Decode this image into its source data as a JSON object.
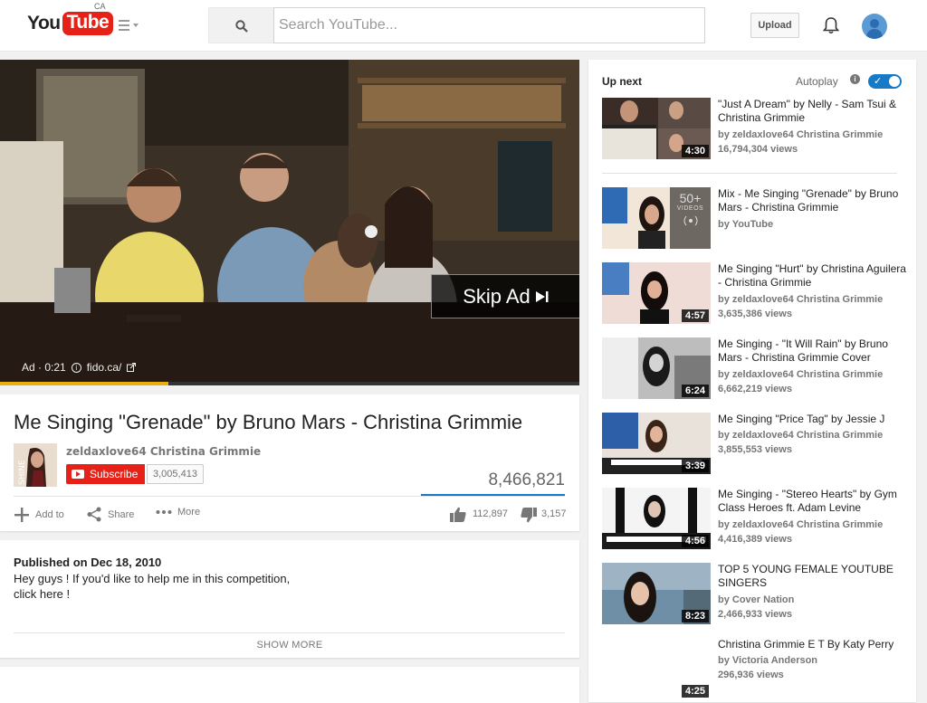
{
  "header": {
    "logo_you": "You",
    "logo_tube": "Tube",
    "logo_region": "CA",
    "search_placeholder": "Search YouTube...",
    "upload_label": "Upload"
  },
  "player": {
    "ad_label": "Ad · 0:21",
    "ad_domain": "fido.ca/",
    "skip_label": "Skip Ad",
    "ad_progress_fraction": 0.29
  },
  "video": {
    "title": "Me Singing \"Grenade\" by Bruno Mars - Christina Grimmie",
    "owner": "zeldaxlove64 Christina Grimmie",
    "subscribe_label": "Subscribe",
    "subscriber_count": "3,005,413",
    "views": "8,466,821",
    "actions": {
      "add_to": "Add to",
      "share": "Share",
      "more": "More"
    },
    "likes": "112,897",
    "dislikes": "3,157"
  },
  "description": {
    "published": "Published on Dec 18, 2010",
    "line1": "Hey guys ! If you'd like to help me in this competition,",
    "line2": "click here !",
    "show_more": "SHOW MORE"
  },
  "sidebar": {
    "up_next": "Up next",
    "autoplay": "Autoplay",
    "items": [
      {
        "title": "\"Just A Dream\" by Nelly - Sam Tsui & Christina Grimmie",
        "by": "by zeldaxlove64 Christina Grimmie",
        "views": "16,794,304 views",
        "duration": "4:30"
      },
      {
        "title": "Mix - Me Singing \"Grenade\" by Bruno Mars - Christina Grimmie",
        "by": "by YouTube",
        "views": "",
        "duration": "",
        "mix_count": "50+",
        "mix_label": "VIDEOS"
      },
      {
        "title": "Me Singing \"Hurt\" by Christina Aguilera - Christina Grimmie",
        "by": "by zeldaxlove64 Christina Grimmie",
        "views": "3,635,386 views",
        "duration": "4:57"
      },
      {
        "title": "Me Singing - \"It Will Rain\" by Bruno Mars - Christina Grimmie Cover",
        "by": "by zeldaxlove64 Christina Grimmie",
        "views": "6,662,219 views",
        "duration": "6:24"
      },
      {
        "title": "Me Singing \"Price Tag\" by Jessie J",
        "by": "by zeldaxlove64 Christina Grimmie",
        "views": "3,855,553 views",
        "duration": "3:39"
      },
      {
        "title": "Me Singing - \"Stereo Hearts\" by Gym Class Heroes ft. Adam Levine",
        "by": "by zeldaxlove64 Christina Grimmie",
        "views": "4,416,389 views",
        "duration": "4:56"
      },
      {
        "title": "TOP 5 YOUNG FEMALE YOUTUBE SINGERS",
        "by": "by Cover Nation",
        "views": "2,466,933 views",
        "duration": "8:23"
      },
      {
        "title": "Christina Grimmie E T By Katy Perry",
        "by": "by Victoria Anderson",
        "views": "296,936 views",
        "duration": "4:25"
      }
    ]
  }
}
